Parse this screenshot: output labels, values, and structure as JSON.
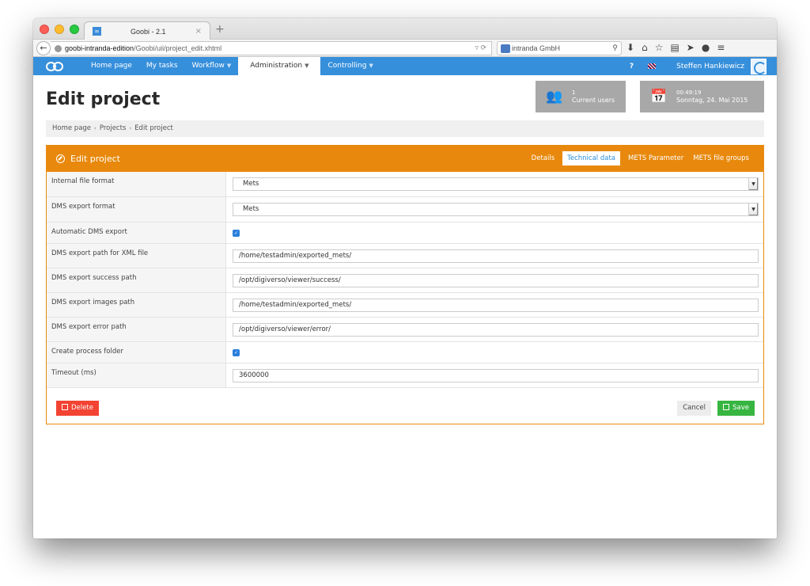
{
  "browser": {
    "tab_title": "Goobi - 2.1",
    "tab_favicon": "∞",
    "tab_close": "×",
    "new_tab": "+",
    "url_host": "goobi-intranda-edition",
    "url_path": "/Goobi/uii/project_edit.xhtml",
    "search_placeholder": "intranda GmbH",
    "toolbar_icons": [
      "download-icon",
      "home-icon",
      "bookmark-star-icon",
      "reading-list-icon",
      "send-icon",
      "chat-icon",
      "menu-icon"
    ],
    "toolbar_glyphs": [
      "⬇",
      "⌂",
      "☆",
      "▤",
      "➤",
      "●",
      "≡"
    ]
  },
  "app_nav": {
    "items": [
      {
        "label": "Home page",
        "dropdown": false
      },
      {
        "label": "My tasks",
        "dropdown": false
      },
      {
        "label": "Workflow",
        "dropdown": true
      },
      {
        "label": "Administration",
        "dropdown": true,
        "active": true
      },
      {
        "label": "Controlling",
        "dropdown": true
      }
    ],
    "help": "?",
    "user_name": "Steffen Hankiewicz"
  },
  "header": {
    "page_title": "Edit project",
    "current_users_count": "1",
    "current_users_label": "Current users",
    "time": "00:49:19",
    "date": "Sonntag, 24. Mai 2015"
  },
  "breadcrumb": [
    "Home page",
    "Projects",
    "Edit project"
  ],
  "panel": {
    "title": "Edit project",
    "tabs": [
      {
        "label": "Details",
        "active": false
      },
      {
        "label": "Technical data",
        "active": true
      },
      {
        "label": "METS Parameter",
        "active": false
      },
      {
        "label": "METS file groups",
        "active": false
      }
    ],
    "fields": [
      {
        "label": "Internal file format",
        "type": "select",
        "value": "Mets"
      },
      {
        "label": "DMS export format",
        "type": "select",
        "value": "Mets"
      },
      {
        "label": "Automatic DMS export",
        "type": "checkbox",
        "checked": true
      },
      {
        "label": "DMS export path for XML file",
        "type": "text",
        "value": "/home/testadmin/exported_mets/"
      },
      {
        "label": "DMS export success path",
        "type": "text",
        "value": "/opt/digiverso/viewer/success/"
      },
      {
        "label": "DMS export images path",
        "type": "text",
        "value": "/home/testadmin/exported_mets/"
      },
      {
        "label": "DMS export error path",
        "type": "text",
        "value": "/opt/digiverso/viewer/error/"
      },
      {
        "label": "Create process folder",
        "type": "checkbox",
        "checked": true
      },
      {
        "label": "Timeout (ms)",
        "type": "text",
        "value": "3600000"
      }
    ],
    "delete_label": "Delete",
    "cancel_label": "Cancel",
    "save_label": "Save"
  },
  "colors": {
    "nav_blue": "#368fdb",
    "panel_orange": "#e8890d",
    "delete_red": "#f34332",
    "save_green": "#36b540",
    "widget_gray": "#a8a8a8"
  }
}
